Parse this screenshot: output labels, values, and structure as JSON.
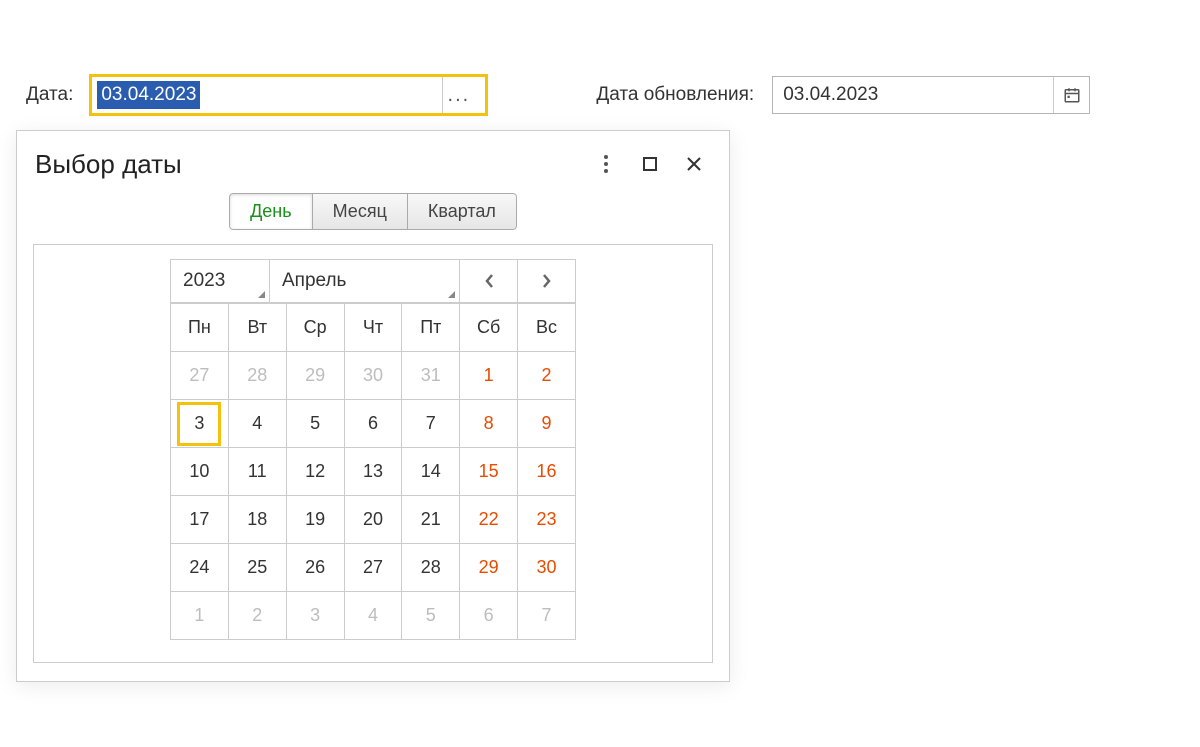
{
  "fields": {
    "date_label": "Дата:",
    "date_value": "03.04.2023",
    "update_label": "Дата обновления:",
    "update_value": "03.04.2023",
    "dots": "..."
  },
  "popup": {
    "title": "Выбор даты",
    "tabs": {
      "day": "День",
      "month": "Месяц",
      "quarter": "Квартал"
    },
    "year": "2023",
    "month": "Апрель",
    "weekdays": [
      "Пн",
      "Вт",
      "Ср",
      "Чт",
      "Пт",
      "Сб",
      "Вс"
    ],
    "weeks": [
      [
        {
          "d": "27",
          "o": true
        },
        {
          "d": "28",
          "o": true
        },
        {
          "d": "29",
          "o": true
        },
        {
          "d": "30",
          "o": true
        },
        {
          "d": "31",
          "o": true
        },
        {
          "d": "1",
          "w": true
        },
        {
          "d": "2",
          "w": true
        }
      ],
      [
        {
          "d": "3",
          "sel": true
        },
        {
          "d": "4"
        },
        {
          "d": "5"
        },
        {
          "d": "6"
        },
        {
          "d": "7"
        },
        {
          "d": "8",
          "w": true
        },
        {
          "d": "9",
          "w": true
        }
      ],
      [
        {
          "d": "10"
        },
        {
          "d": "11"
        },
        {
          "d": "12"
        },
        {
          "d": "13"
        },
        {
          "d": "14"
        },
        {
          "d": "15",
          "w": true
        },
        {
          "d": "16",
          "w": true
        }
      ],
      [
        {
          "d": "17"
        },
        {
          "d": "18"
        },
        {
          "d": "19"
        },
        {
          "d": "20"
        },
        {
          "d": "21"
        },
        {
          "d": "22",
          "w": true
        },
        {
          "d": "23",
          "w": true
        }
      ],
      [
        {
          "d": "24"
        },
        {
          "d": "25"
        },
        {
          "d": "26"
        },
        {
          "d": "27"
        },
        {
          "d": "28"
        },
        {
          "d": "29",
          "w": true
        },
        {
          "d": "30",
          "w": true
        }
      ],
      [
        {
          "d": "1",
          "o": true
        },
        {
          "d": "2",
          "o": true
        },
        {
          "d": "3",
          "o": true
        },
        {
          "d": "4",
          "o": true
        },
        {
          "d": "5",
          "o": true
        },
        {
          "d": "6",
          "o": true
        },
        {
          "d": "7",
          "o": true
        }
      ]
    ]
  }
}
